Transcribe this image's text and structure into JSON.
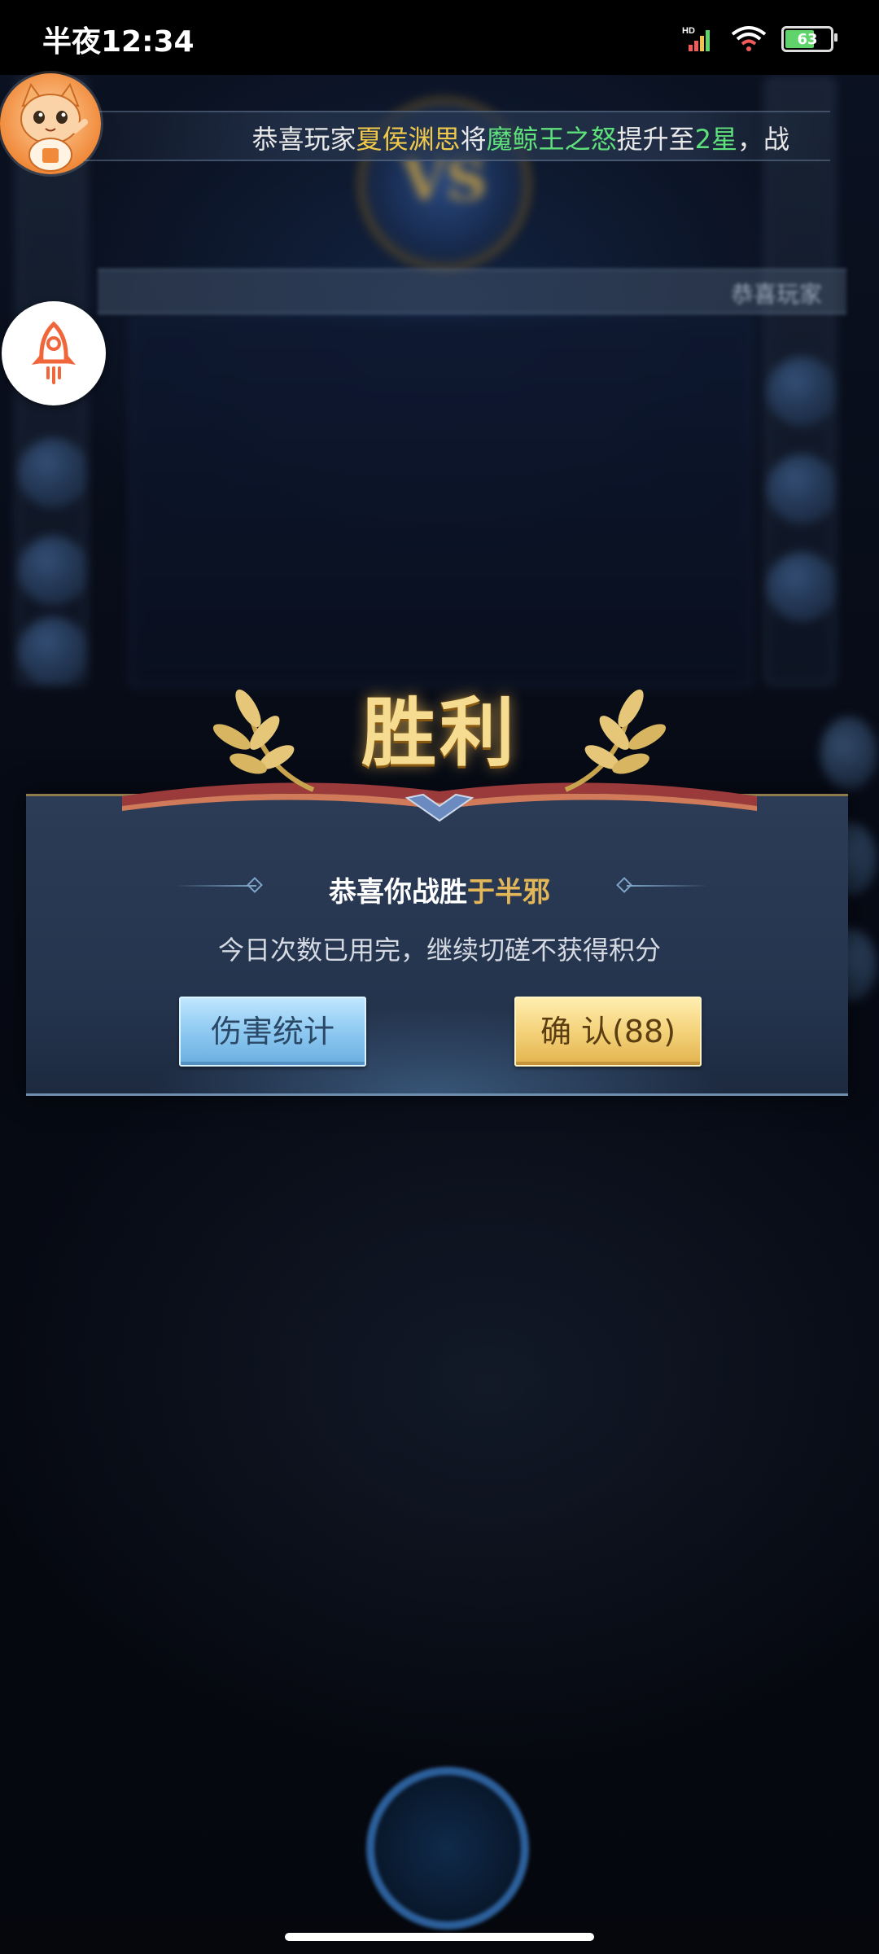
{
  "status_bar": {
    "time": "半夜12:34",
    "network_label": "HD",
    "battery_level": "63",
    "icons": [
      "signal-icon",
      "wifi-icon",
      "battery-icon"
    ]
  },
  "marquee": {
    "prefix": "恭喜玩家",
    "player": "夏侯渊思",
    "verb": "将",
    "item": "魔鲸王之怒",
    "action": "提升至",
    "stars": "2星",
    "suffix": "，战"
  },
  "marquee2": {
    "text": "恭喜玩家"
  },
  "background": {
    "vs_label": "VS"
  },
  "dialog": {
    "title": "胜利",
    "win_prefix": "恭喜你战胜",
    "opponent": "于半邪",
    "notice": "今日次数已用完，继续切磋不获得积分",
    "damage_stats_label": "伤害统计",
    "confirm_label": "确 认(88)"
  },
  "colors": {
    "gold_text": "#f0c94a",
    "green_text": "#5ee07a",
    "title_gold": "#f6dc91",
    "stats_button": "#8ec9f1",
    "confirm_button": "#f4d27a"
  }
}
